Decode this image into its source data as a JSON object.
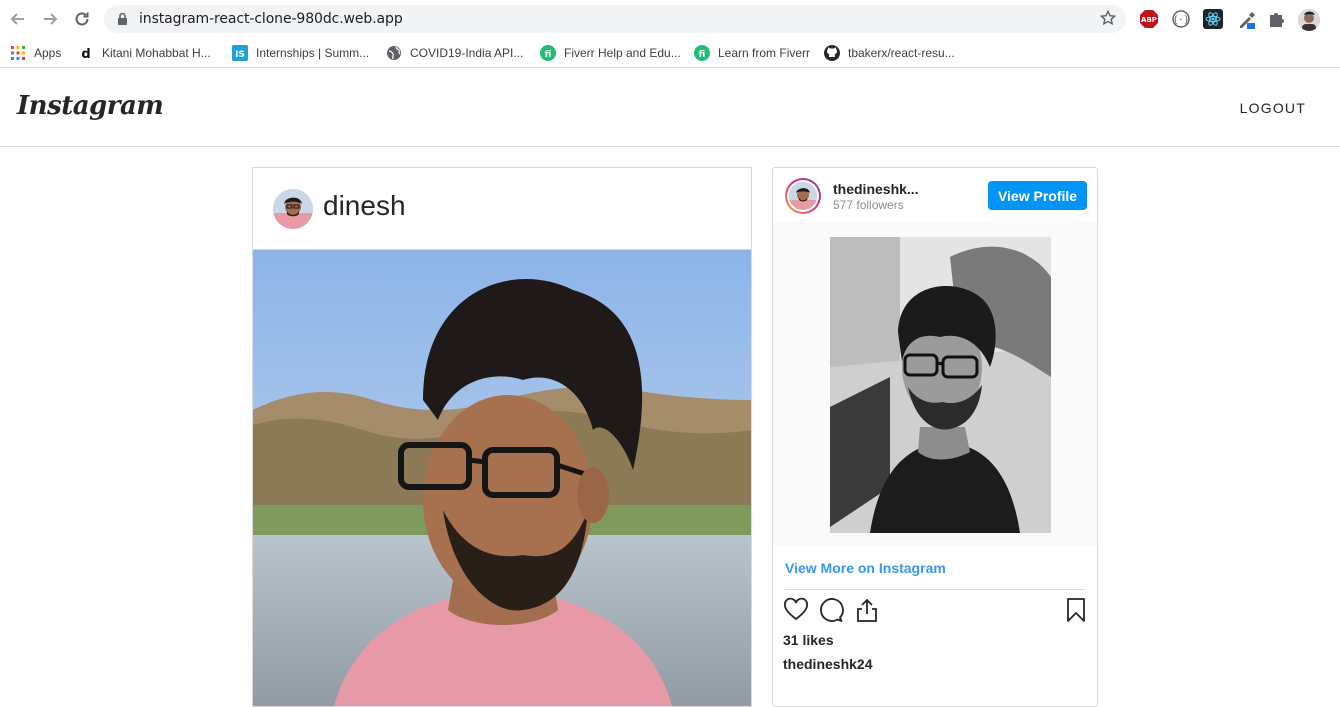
{
  "browser": {
    "url": "instagram-react-clone-980dc.web.app",
    "bookmarks": [
      {
        "label": "Apps",
        "icon": "apps-grid-icon"
      },
      {
        "label": "Kitani Mohabbat H...",
        "icon": "d-letter-icon"
      },
      {
        "label": "Internships | Summ...",
        "icon": "is-logo-icon"
      },
      {
        "label": "COVID19-India API...",
        "icon": "globe-icon"
      },
      {
        "label": "Fiverr Help and Edu...",
        "icon": "fiverr-icon"
      },
      {
        "label": "Learn from Fiverr",
        "icon": "fiverr-icon"
      },
      {
        "label": "tbakerx/react-resu...",
        "icon": "github-icon"
      }
    ],
    "extensions": [
      "abp-icon",
      "json-viewer-icon",
      "react-devtools-icon",
      "color-picker-icon",
      "puzzle-icon",
      "profile-avatar-icon"
    ]
  },
  "header": {
    "logo": "Instagram",
    "logout_label": "LOGOUT"
  },
  "post": {
    "username": "dinesh"
  },
  "embed": {
    "username": "thedineshk...",
    "followers": "577 followers",
    "view_profile_label": "View Profile",
    "view_more_label": "View More on Instagram",
    "likes": "31 likes",
    "caption_user": "thedineshk24"
  },
  "colors": {
    "accent": "#0095f6",
    "link": "#3897f0",
    "border": "#dbdbdb"
  }
}
